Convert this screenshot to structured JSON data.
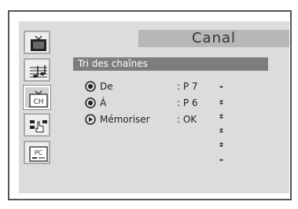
{
  "menu": {
    "title": "Canal",
    "section_label": "Tri des chaînes",
    "rows": [
      {
        "label": "De",
        "value": ": P  7",
        "placeholder": "-----",
        "icon": "radio-dot-icon"
      },
      {
        "label": "Á",
        "value": ": P  6",
        "placeholder": "-----",
        "icon": "radio-dot-icon"
      },
      {
        "label": "Mémoriser",
        "value": ": OK",
        "icon": "play-triangle-icon"
      }
    ]
  },
  "sidebar": {
    "items": [
      {
        "name": "tv-picture-icon"
      },
      {
        "name": "sound-note-icon"
      },
      {
        "name": "channel-tv-icon",
        "text": "CH",
        "active": true
      },
      {
        "name": "setup-hand-icon"
      },
      {
        "name": "pc-icon",
        "text": "PC"
      }
    ]
  },
  "colors": {
    "panel": "#dcdcdc",
    "title_bar": "#b7b7b7",
    "section_bar": "#7d7d7d"
  }
}
